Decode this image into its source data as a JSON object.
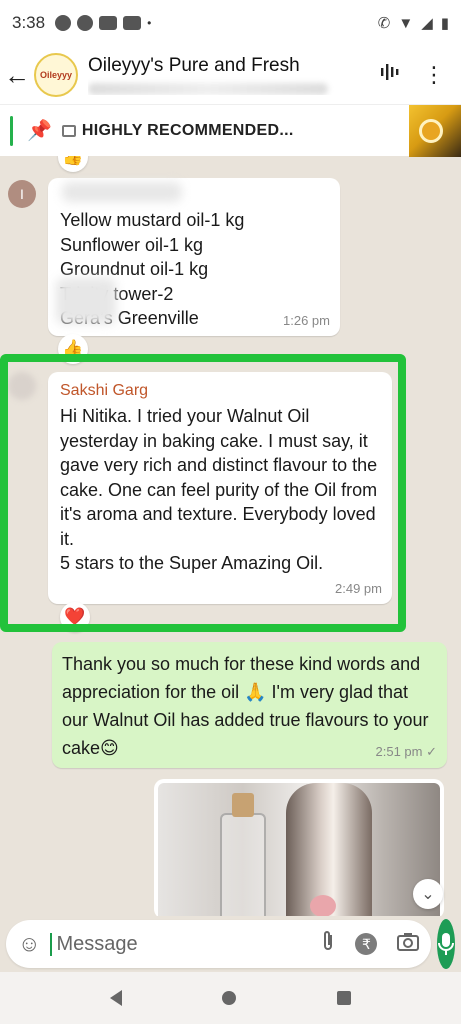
{
  "status_bar": {
    "time": "3:38"
  },
  "header": {
    "title": "Oileyyy's Pure and Fresh",
    "avatar_text": "Oileyyy"
  },
  "pinned": {
    "label": "HIGHLY RECOMMENDED..."
  },
  "messages": {
    "m1": {
      "avatar_initial": "I",
      "text": "Yellow mustard oil-1 kg\nSunflower oil-1 kg\nGroundnut oil-1 kg\nTrinity tower-2\nGera’s Greenville",
      "time": "1:26 pm",
      "reaction": "👍"
    },
    "m2": {
      "sender": "Sakshi Garg",
      "text": "Hi Nitika. I tried your Walnut Oil yesterday in baking cake. I must say, it gave very rich and distinct flavour to the cake. One can feel purity of the Oil from it's aroma and texture. Everybody loved it.\n5 stars to the Super Amazing Oil.",
      "time": "2:49 pm",
      "reaction": "❤️"
    },
    "m3": {
      "text": "Thank you so much for these kind words and appreciation for the oil 🙏 I'm very glad that our Walnut Oil has added true flavours to your cake😊",
      "time": "2:51 pm ✓"
    }
  },
  "top_reaction": "👍",
  "input": {
    "placeholder": "Message"
  },
  "icons": {
    "back": "arrow-left-icon",
    "voice": "audio-wave-icon",
    "menu": "more-vertical-icon",
    "pin": "pin-icon",
    "emoji": "emoji-icon",
    "attach": "paperclip-icon",
    "payment": "rupee-icon",
    "camera": "camera-icon",
    "mic": "mic-icon",
    "scroll": "chevrons-down-icon"
  },
  "colors": {
    "accent": "#1d9c55",
    "highlight_frame": "#22c23a",
    "outgoing_bubble": "#d8f5c6",
    "sender_name": "#c0562a"
  }
}
